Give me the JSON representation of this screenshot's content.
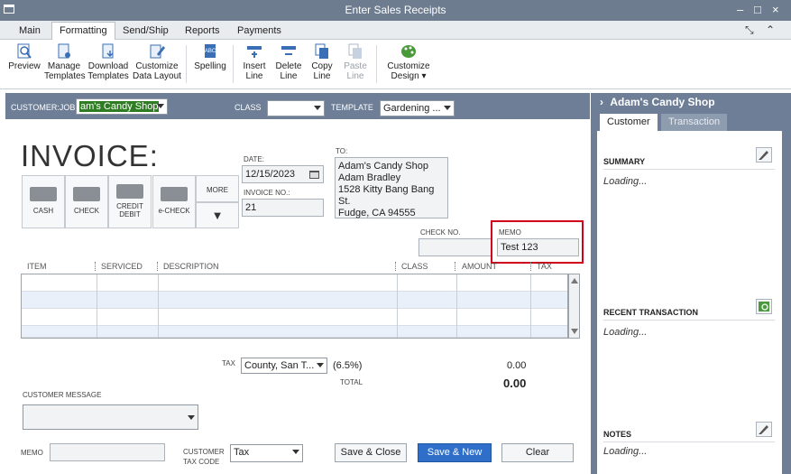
{
  "window": {
    "title": "Enter Sales Receipts",
    "minimize": "–",
    "maximize": "□",
    "close": "×"
  },
  "tabs": [
    "Main",
    "Formatting",
    "Send/Ship",
    "Reports",
    "Payments"
  ],
  "tab_controls": {
    "expand": "⤡",
    "collapse": "⌃"
  },
  "ribbon": {
    "preview": "Preview",
    "manage_1": "Manage",
    "manage_2": "Templates",
    "download_1": "Download",
    "download_2": "Templates",
    "customize_1": "Customize",
    "customize_2": "Data Layout",
    "spelling": "Spelling",
    "insert_1": "Insert",
    "insert_2": "Line",
    "delete_1": "Delete",
    "delete_2": "Line",
    "copy_1": "Copy",
    "copy_2": "Line",
    "paste_1": "Paste",
    "paste_2": "Line",
    "design_1": "Customize",
    "design_2": "Design ▾"
  },
  "header": {
    "customer_job_label": "CUSTOMER:JOB",
    "customer_job_value": "am's Candy Shop",
    "class_label": "CLASS",
    "class_value": "",
    "template_label": "TEMPLATE",
    "template_value": "Gardening ..."
  },
  "form": {
    "title": "INVOICE:",
    "date_label": "DATE:",
    "date_value": "12/15/2023",
    "invoice_no_label": "INVOICE NO.:",
    "invoice_no_value": "21",
    "to_label": "TO:",
    "address_lines": [
      "Adam's Candy Shop",
      "Adam Bradley",
      "1528 Kitty Bang Bang St.",
      "Fudge, CA 94555"
    ],
    "check_no_label": "CHECK NO.",
    "check_no_value": "",
    "memo_label": "MEMO",
    "memo_value": "Test 123"
  },
  "payment_methods": {
    "cash": "CASH",
    "check": "CHECK",
    "credit_1": "CREDIT",
    "credit_2": "DEBIT",
    "echeck": "e-CHECK",
    "more": "MORE",
    "more_arrow": "▼"
  },
  "grid": {
    "columns": [
      "ITEM",
      "SERVICED",
      "DESCRIPTION",
      "CLASS",
      "AMOUNT",
      "TAX"
    ]
  },
  "totals": {
    "tax_label": "TAX",
    "tax_code": "County, San T...",
    "tax_rate": "(6.5%)",
    "tax_amount": "0.00",
    "total_label": "TOTAL",
    "total_value": "0.00"
  },
  "footer": {
    "customer_message_label": "CUSTOMER MESSAGE",
    "memo_label": "MEMO",
    "customer_tax_code_label_1": "CUSTOMER",
    "customer_tax_code_label_2": "TAX CODE",
    "customer_tax_code_value": "Tax",
    "save_close": "Save & Close",
    "save_new": "Save & New",
    "clear": "Clear"
  },
  "side_panel": {
    "header": "Adam's Candy Shop",
    "chevron": "›",
    "tab_customer": "Customer",
    "tab_transaction": "Transaction",
    "summary_title": "SUMMARY",
    "summary_text": "Loading...",
    "recent_title": "RECENT TRANSACTION",
    "recent_text": "Loading...",
    "notes_title": "NOTES",
    "notes_text": "Loading..."
  }
}
